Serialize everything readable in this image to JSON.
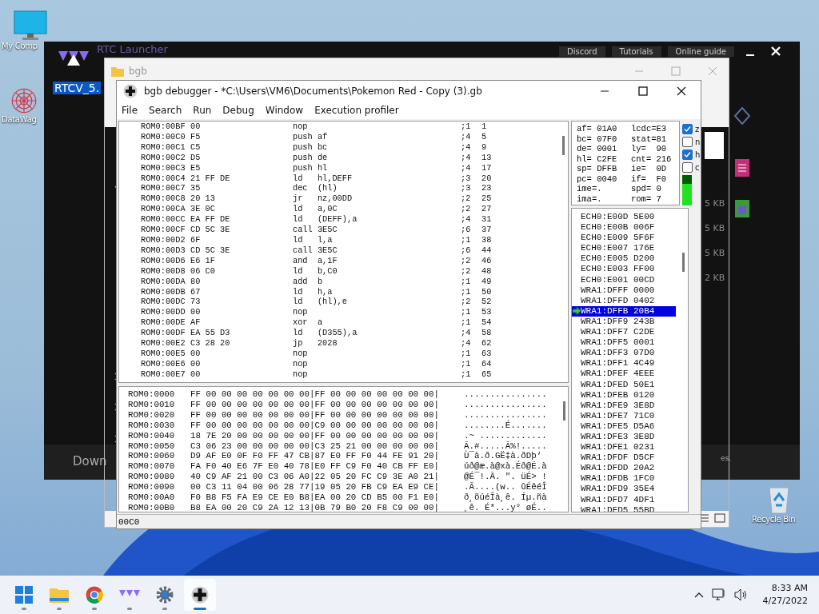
{
  "desktop": {
    "icons": [
      {
        "kind": "computer",
        "label": "My Comp"
      },
      {
        "kind": "spiral",
        "label": "DataWag"
      },
      {
        "kind": "recycle",
        "label": "Recycle Bin"
      }
    ]
  },
  "launcher": {
    "title": "RTC Launcher",
    "links": [
      "Discord",
      "Tutorials",
      "Online guide"
    ],
    "selected_text": "RTCV_5.",
    "size_labels": [
      "5 KB",
      "5 KB",
      "5 KB",
      "2 KB"
    ],
    "footer_button": "Down",
    "footer_note": "es."
  },
  "explorer_window": {
    "title": "bgb"
  },
  "debugger": {
    "title": "bgb debugger - *C:\\Users\\VM6\\Documents\\Pokemon Red - Copy (3).gb",
    "menu": [
      "File",
      "Search",
      "Run",
      "Debug",
      "Window",
      "Execution profiler"
    ],
    "disassembly": [
      {
        "address": "ROM0:00BF",
        "bytes": "00",
        "instruction": "nop",
        "cycles": ";1",
        "total": "1"
      },
      {
        "address": "ROM0:00C0",
        "bytes": "F5",
        "instruction": "push af",
        "cycles": ";4",
        "total": "5"
      },
      {
        "address": "ROM0:00C1",
        "bytes": "C5",
        "instruction": "push bc",
        "cycles": ";4",
        "total": "9"
      },
      {
        "address": "ROM0:00C2",
        "bytes": "D5",
        "instruction": "push de",
        "cycles": ";4",
        "total": "13"
      },
      {
        "address": "ROM0:00C3",
        "bytes": "E5",
        "instruction": "push hl",
        "cycles": ";4",
        "total": "17"
      },
      {
        "address": "ROM0:00C4",
        "bytes": "21 FF DE",
        "instruction": "ld   hl,DEFF",
        "cycles": ";3",
        "total": "20"
      },
      {
        "address": "ROM0:00C7",
        "bytes": "35",
        "instruction": "dec  (hl)",
        "cycles": ";3",
        "total": "23"
      },
      {
        "address": "ROM0:00C8",
        "bytes": "20 13",
        "instruction": "jr   nz,00DD",
        "cycles": ";2",
        "total": "25"
      },
      {
        "address": "ROM0:00CA",
        "bytes": "3E 0C",
        "instruction": "ld   a,0C",
        "cycles": ";2",
        "total": "27"
      },
      {
        "address": "ROM0:00CC",
        "bytes": "EA FF DE",
        "instruction": "ld   (DEFF),a",
        "cycles": ";4",
        "total": "31"
      },
      {
        "address": "ROM0:00CF",
        "bytes": "CD 5C 3E",
        "instruction": "call 3E5C",
        "cycles": ";6",
        "total": "37"
      },
      {
        "address": "ROM0:00D2",
        "bytes": "6F",
        "instruction": "ld   l,a",
        "cycles": ";1",
        "total": "38"
      },
      {
        "address": "ROM0:00D3",
        "bytes": "CD 5C 3E",
        "instruction": "call 3E5C",
        "cycles": ";6",
        "total": "44"
      },
      {
        "address": "ROM0:00D6",
        "bytes": "E6 1F",
        "instruction": "and  a,1F",
        "cycles": ";2",
        "total": "46"
      },
      {
        "address": "ROM0:00D8",
        "bytes": "06 C0",
        "instruction": "ld   b,C0",
        "cycles": ";2",
        "total": "48"
      },
      {
        "address": "ROM0:00DA",
        "bytes": "80",
        "instruction": "add  b",
        "cycles": ";1",
        "total": "49"
      },
      {
        "address": "ROM0:00DB",
        "bytes": "67",
        "instruction": "ld   h,a",
        "cycles": ";1",
        "total": "50"
      },
      {
        "address": "ROM0:00DC",
        "bytes": "73",
        "instruction": "ld   (hl),e",
        "cycles": ";2",
        "total": "52"
      },
      {
        "address": "ROM0:00DD",
        "bytes": "00",
        "instruction": "nop",
        "cycles": ";1",
        "total": "53"
      },
      {
        "address": "ROM0:00DE",
        "bytes": "AF",
        "instruction": "xor  a",
        "cycles": ";1",
        "total": "54"
      },
      {
        "address": "ROM0:00DF",
        "bytes": "EA 55 D3",
        "instruction": "ld   (D355),a",
        "cycles": ";4",
        "total": "58"
      },
      {
        "address": "ROM0:00E2",
        "bytes": "C3 28 20",
        "instruction": "jp   2028",
        "cycles": ";4",
        "total": "62"
      },
      {
        "address": "ROM0:00E5",
        "bytes": "00",
        "instruction": "nop",
        "cycles": ";1",
        "total": "63"
      },
      {
        "address": "ROM0:00E6",
        "bytes": "00",
        "instruction": "nop",
        "cycles": ";1",
        "total": "64"
      },
      {
        "address": "ROM0:00E7",
        "bytes": "00",
        "instruction": "nop",
        "cycles": ";1",
        "total": "65"
      }
    ],
    "registers": [
      [
        "af= 01A0",
        "lcdc=E3"
      ],
      [
        "bc= 07F0",
        "stat=81"
      ],
      [
        "de= 0001",
        "ly=  90"
      ],
      [
        "hl= C2FE",
        "cnt= 216"
      ],
      [
        "sp= DFFB",
        "ie=  0D"
      ],
      [
        "pc= 0040",
        "if=  F0"
      ],
      [
        "ime=.",
        "spd= 0"
      ],
      [
        "ima=.",
        "rom= 7"
      ]
    ],
    "flags": [
      {
        "label": "z",
        "checked": true
      },
      {
        "label": "n",
        "checked": false
      },
      {
        "label": "h",
        "checked": true
      },
      {
        "label": "c",
        "checked": false
      }
    ],
    "meter": {
      "level": 0.72
    },
    "stack": [
      {
        "address": "ECH0:E00D",
        "value": "5E00",
        "selected": false
      },
      {
        "address": "ECH0:E00B",
        "value": "006F",
        "selected": false
      },
      {
        "address": "ECH0:E009",
        "value": "5F6F",
        "selected": false
      },
      {
        "address": "ECH0:E007",
        "value": "176E",
        "selected": false
      },
      {
        "address": "ECH0:E005",
        "value": "D200",
        "selected": false
      },
      {
        "address": "ECH0:E003",
        "value": "FF00",
        "selected": false
      },
      {
        "address": "ECH0:E001",
        "value": "00CD",
        "selected": false
      },
      {
        "address": "WRA1:DFFF",
        "value": "0000",
        "selected": false
      },
      {
        "address": "WRA1:DFFD",
        "value": "0402",
        "selected": false
      },
      {
        "address": "WRA1:DFFB",
        "value": "20B4",
        "selected": true
      },
      {
        "address": "WRA1:DFF9",
        "value": "243B",
        "selected": false
      },
      {
        "address": "WRA1:DFF7",
        "value": "C2DE",
        "selected": false
      },
      {
        "address": "WRA1:DFF5",
        "value": "0001",
        "selected": false
      },
      {
        "address": "WRA1:DFF3",
        "value": "07D0",
        "selected": false
      },
      {
        "address": "WRA1:DFF1",
        "value": "4C49",
        "selected": false
      },
      {
        "address": "WRA1:DFEF",
        "value": "4EEE",
        "selected": false
      },
      {
        "address": "WRA1:DFED",
        "value": "50E1",
        "selected": false
      },
      {
        "address": "WRA1:DFEB",
        "value": "0120",
        "selected": false
      },
      {
        "address": "WRA1:DFE9",
        "value": "3E8D",
        "selected": false
      },
      {
        "address": "WRA1:DFE7",
        "value": "71C0",
        "selected": false
      },
      {
        "address": "WRA1:DFE5",
        "value": "D5A6",
        "selected": false
      },
      {
        "address": "WRA1:DFE3",
        "value": "3E8D",
        "selected": false
      },
      {
        "address": "WRA1:DFE1",
        "value": "0231",
        "selected": false
      },
      {
        "address": "WRA1:DFDF",
        "value": "D5CF",
        "selected": false
      },
      {
        "address": "WRA1:DFDD",
        "value": "20A2",
        "selected": false
      },
      {
        "address": "WRA1:DFDB",
        "value": "1FC0",
        "selected": false
      },
      {
        "address": "WRA1:DFD9",
        "value": "35E4",
        "selected": false
      },
      {
        "address": "WRA1:DFD7",
        "value": "4DF1",
        "selected": false
      },
      {
        "address": "WRA1:DFD5",
        "value": "55BD",
        "selected": false
      }
    ],
    "memory": [
      {
        "address": "ROM0:0000",
        "bytes": "FF 00 00 00 00 00 00 00|FF 00 00 00 00 00 00 00|",
        "ascii": "................"
      },
      {
        "address": "ROM0:0010",
        "bytes": "FF 00 00 00 00 00 00 00|FF 00 00 00 00 00 00 00|",
        "ascii": "................"
      },
      {
        "address": "ROM0:0020",
        "bytes": "FF 00 00 00 00 00 00 00|FF 00 00 00 00 00 00 00|",
        "ascii": "................"
      },
      {
        "address": "ROM0:0030",
        "bytes": "FF 00 00 00 00 00 00 00|C9 00 00 00 00 00 00 00|",
        "ascii": "........É......."
      },
      {
        "address": "ROM0:0040",
        "bytes": "18 7E 20 00 00 00 00 00|FF 00 00 00 00 00 00 00|",
        "ascii": ".~ ............."
      },
      {
        "address": "ROM0:0050",
        "bytes": "C3 06 23 00 00 00 00 00|C3 25 21 00 00 00 00 00|",
        "ascii": "Ã.#.....Ã%!....."
      },
      {
        "address": "ROM0:0060",
        "bytes": "D9 AF E0 0F F0 FF 47 CB|87 E0 FF F0 44 FE 91 20|",
        "ascii": "Ù¯à.ð.GË‡à.ðDþ‘ "
      },
      {
        "address": "ROM0:0070",
        "bytes": "FA F0 40 E6 7F E0 40 78|E0 FF C9 F0 40 CB FF E0|",
        "ascii": "úð@æ.à@xà.Éð@Ë.à"
      },
      {
        "address": "ROM0:0080",
        "bytes": "40 C9 AF 21 00 C3 06 A0|22 05 20 FC C9 3E A0 21|",
        "ascii": "@É¯!.Ã. \". üÉ> !"
      },
      {
        "address": "ROM0:0090",
        "bytes": "00 C3 11 04 00 06 28 77|19 05 20 FB C9 EA E9 CE|",
        "ascii": ".Ã....(w.. ûÉêéÎ"
      },
      {
        "address": "ROM0:00A0",
        "bytes": "F0 B8 F5 FA E9 CE E0 B8|EA 00 20 CD B5 00 F1 E0|",
        "ascii": "ð¸õúéÎà¸ê. Íµ.ñà"
      },
      {
        "address": "ROM0:00B0",
        "bytes": "B8 EA 00 20 C9 2A 12 13|0B 79 B0 20 F8 C9 00 00|",
        "ascii": "¸ê. É*...y° øÉ.."
      }
    ],
    "status": "00C0"
  },
  "taskbar": {
    "apps": [
      {
        "kind": "start",
        "selected": false
      },
      {
        "kind": "folder",
        "selected": false
      },
      {
        "kind": "browser",
        "selected": false
      },
      {
        "kind": "launcher",
        "selected": false
      },
      {
        "kind": "gear",
        "selected": false
      },
      {
        "kind": "gamepad",
        "selected": true
      }
    ],
    "clock": {
      "time": "8:33 AM",
      "date": "4/27/2022"
    }
  }
}
